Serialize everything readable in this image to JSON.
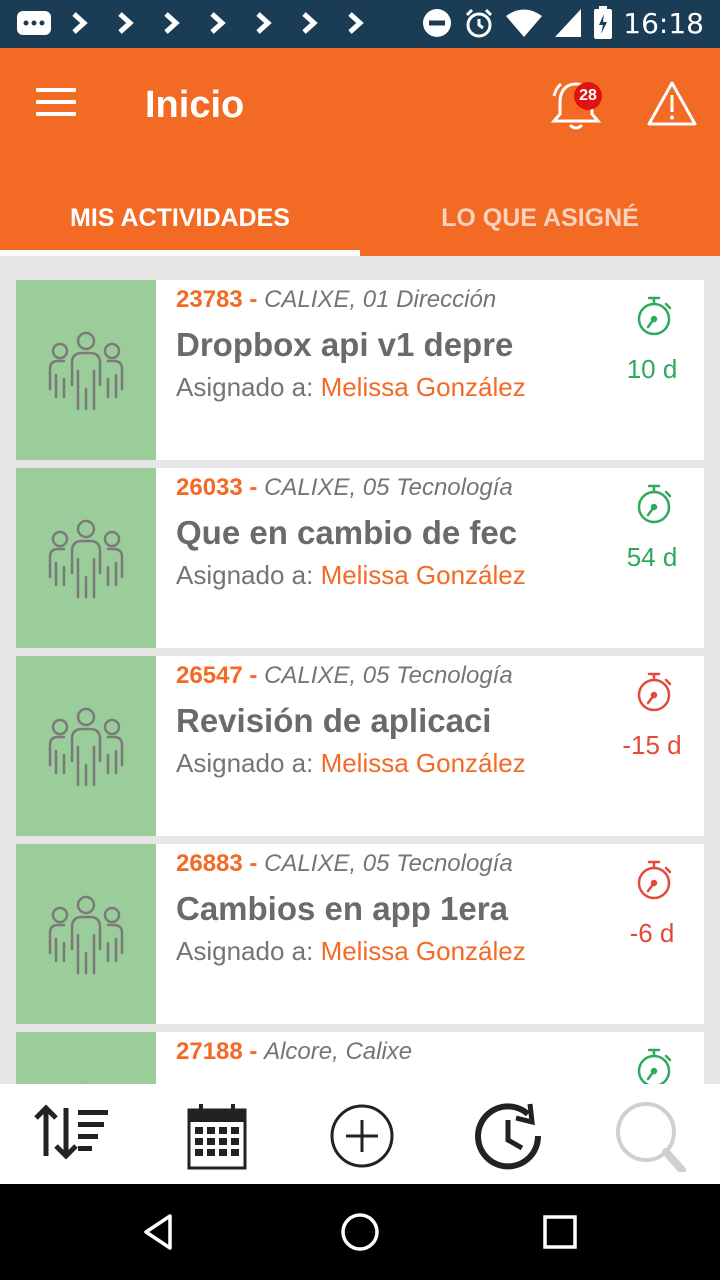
{
  "status_bar": {
    "time": "16:18",
    "icons": [
      "notification-icon",
      "chevron-right-icon",
      "chevron-right-icon",
      "chevron-right-icon",
      "chevron-right-icon",
      "chevron-right-icon",
      "chevron-right-icon",
      "chevron-right-icon",
      "do-not-disturb-icon",
      "alarm-icon",
      "wifi-icon",
      "cell-signal-icon",
      "battery-charging-icon"
    ]
  },
  "app_bar": {
    "title": "Inicio",
    "notification_count": "28",
    "color": "#f26a24"
  },
  "tabs": [
    {
      "label": "MIS ACTIVIDADES",
      "active": true
    },
    {
      "label": "LO QUE ASIGNÉ",
      "active": false
    }
  ],
  "activities": [
    {
      "id": "23783",
      "separator": " - ",
      "dept": "CALIXE, 01 Dirección",
      "title": "Dropbox api v1 depre",
      "assigned_label": "Asignado a: ",
      "assignee": "Melissa González",
      "days": "10 d",
      "status_color": "#2eaa5e"
    },
    {
      "id": "26033",
      "separator": " - ",
      "dept": "CALIXE, 05 Tecnología",
      "title": "Que en cambio de fec",
      "assigned_label": "Asignado a: ",
      "assignee": "Melissa González",
      "days": "54 d",
      "status_color": "#2eaa5e"
    },
    {
      "id": "26547",
      "separator": " - ",
      "dept": "CALIXE, 05 Tecnología",
      "title": "Revisión de aplicaci",
      "assigned_label": "Asignado a: ",
      "assignee": "Melissa González",
      "days": "-15 d",
      "status_color": "#e04b3a"
    },
    {
      "id": "26883",
      "separator": " - ",
      "dept": "CALIXE, 05 Tecnología",
      "title": "Cambios en app 1era",
      "assigned_label": "Asignado a: ",
      "assignee": "Melissa González",
      "days": "-6 d",
      "status_color": "#e04b3a"
    },
    {
      "id": "27188",
      "separator": " - ",
      "dept": "Alcore, Calixe",
      "title": "",
      "assigned_label": "",
      "assignee": "",
      "days": "",
      "status_color": "#2eaa5e"
    }
  ],
  "bottom_bar": {
    "icons": [
      "sort-icon",
      "calendar-icon",
      "add-circle-icon",
      "history-icon",
      "search-icon"
    ]
  },
  "nav_bar": {
    "icons": [
      "back-icon",
      "home-icon",
      "recents-icon"
    ]
  }
}
